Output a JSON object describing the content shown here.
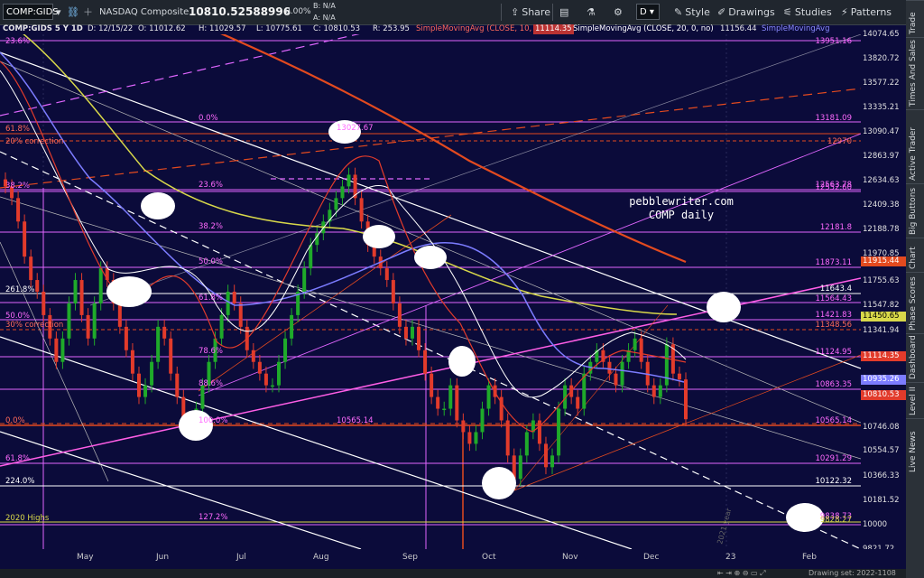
{
  "toolbar": {
    "symbol": "COMP:GIDS",
    "name": "NASDAQ Composite",
    "last": "10810.52588996",
    "change": "0.00%",
    "bid": "B: N/A",
    "ask": "A: N/A",
    "share": "Share",
    "style": "Style",
    "drawings": "Drawings",
    "studies": "Studies",
    "patterns": "Patterns"
  },
  "info": {
    "symbol": "COMP:GIDS 5 Y 1D",
    "date": "D: 12/15/22",
    "open": "O: 11012.62",
    "high": "H: 11029.57",
    "low": "L: 10775.61",
    "close": "C: 10810.53",
    "range": "R: 253.95",
    "sma10": "SimpleMovingAvg (CLOSE, 10, 0, no)",
    "sma10_val": "11114.35",
    "sma20": "SimpleMovingAvg (CLOSE, 20, 0, no)",
    "sma20_val": "11156.44",
    "sma_more": "SimpleMovingAvg"
  },
  "chart_data": {
    "type": "candlestick",
    "title": "pebblewriter.com",
    "subtitle": "COMP daily",
    "ylim": [
      9700,
      14100
    ],
    "x_months": [
      "May",
      "Jun",
      "Jul",
      "Aug",
      "Sep",
      "Oct",
      "Nov",
      "Dec",
      "23",
      "Feb"
    ],
    "y_ticks": [
      "14074.65",
      "13820.72",
      "13577.22",
      "13335.21",
      "13090.47",
      "12863.97",
      "12634.63",
      "12409.38",
      "12188.78",
      "11970.85",
      "11755.63",
      "11547.82",
      "11341.94",
      "11136.00",
      "10746.08",
      "10554.57",
      "10366.33",
      "10181.52",
      "10000",
      "9821.72"
    ],
    "levels_right": [
      "13951.16",
      "13181.09",
      "12970",
      "12563.78",
      "12552.60",
      "12181.8",
      "11873.11",
      "11643.4",
      "11564.43",
      "11421.83",
      "11348.56",
      "11124.95",
      "10863.35",
      "10565.14",
      "10291.29",
      "10122.32",
      "9838.73",
      "9828.27"
    ],
    "levels_left": [
      "23.6%",
      "61.8%",
      "20% correction",
      "38.2%",
      "261.8%",
      "50.0%",
      "30% correction",
      "0.0%",
      "61.8%",
      "224.0%",
      "2020 Highs"
    ],
    "fib_labels": [
      "0.0%",
      "23.6%",
      "38.2%",
      "50.0%",
      "61.8%",
      "78.6%",
      "88.6%",
      "100.0%",
      "127.2%"
    ],
    "annotations": [
      "13027.67",
      "10565.14",
      "2021 year"
    ],
    "price_tags": [
      "11915.44",
      "11450.65",
      "11114.35",
      "10935.26",
      "10810.53"
    ],
    "closes": [
      12800,
      12700,
      12500,
      12200,
      12000,
      11900,
      11700,
      11500,
      11300,
      11500,
      11800,
      12000,
      11700,
      11500,
      11800,
      12100,
      12000,
      11800,
      11600,
      11400,
      11200,
      11000,
      11100,
      11300,
      11600,
      11500,
      11200,
      11000,
      10800,
      10700,
      10900,
      11100,
      11300,
      11500,
      11700,
      11900,
      11800,
      11600,
      11400,
      11300,
      11200,
      11100,
      11100,
      11300,
      11500,
      11700,
      11900,
      12100,
      12300,
      12400,
      12500,
      12600,
      12700,
      12800,
      12900,
      12700,
      12500,
      12300,
      12200,
      12100,
      12000,
      11800,
      11600,
      11500,
      11600,
      11400,
      11200,
      11000,
      10900,
      10900,
      11100,
      10800,
      10700,
      10600,
      10700,
      10900,
      11100,
      11000,
      10800,
      10500,
      10300,
      10500,
      10700,
      10800,
      10600,
      10400,
      10500,
      10900,
      11100,
      11000,
      10900,
      11200,
      11300,
      11400,
      11300,
      11200,
      11100,
      11300,
      11400,
      11500,
      11300,
      11100,
      11000,
      11100,
      11450,
      11200,
      11150,
      10810
    ],
    "ytd_highs_note": "2020 Highs"
  },
  "axis_labels": [
    "2021 year"
  ],
  "bottom": {
    "drawing_set": "Drawing set: 2022-1108"
  },
  "rightnav": [
    "Trade",
    "Times And Sales",
    "Active Trader",
    "Big Buttons",
    "Chart",
    "Phase Scores",
    "Dashboard",
    "Level II",
    "Live News"
  ],
  "colors": {
    "background": "#0b0b3a",
    "sma10": "#e23b2b",
    "sma20": "#ffffff",
    "sma50": "#7c7cff",
    "sma100": "#d8d84a",
    "sma200": "#e34a1f",
    "up": "#1faa2a",
    "down": "#e23b2b"
  }
}
